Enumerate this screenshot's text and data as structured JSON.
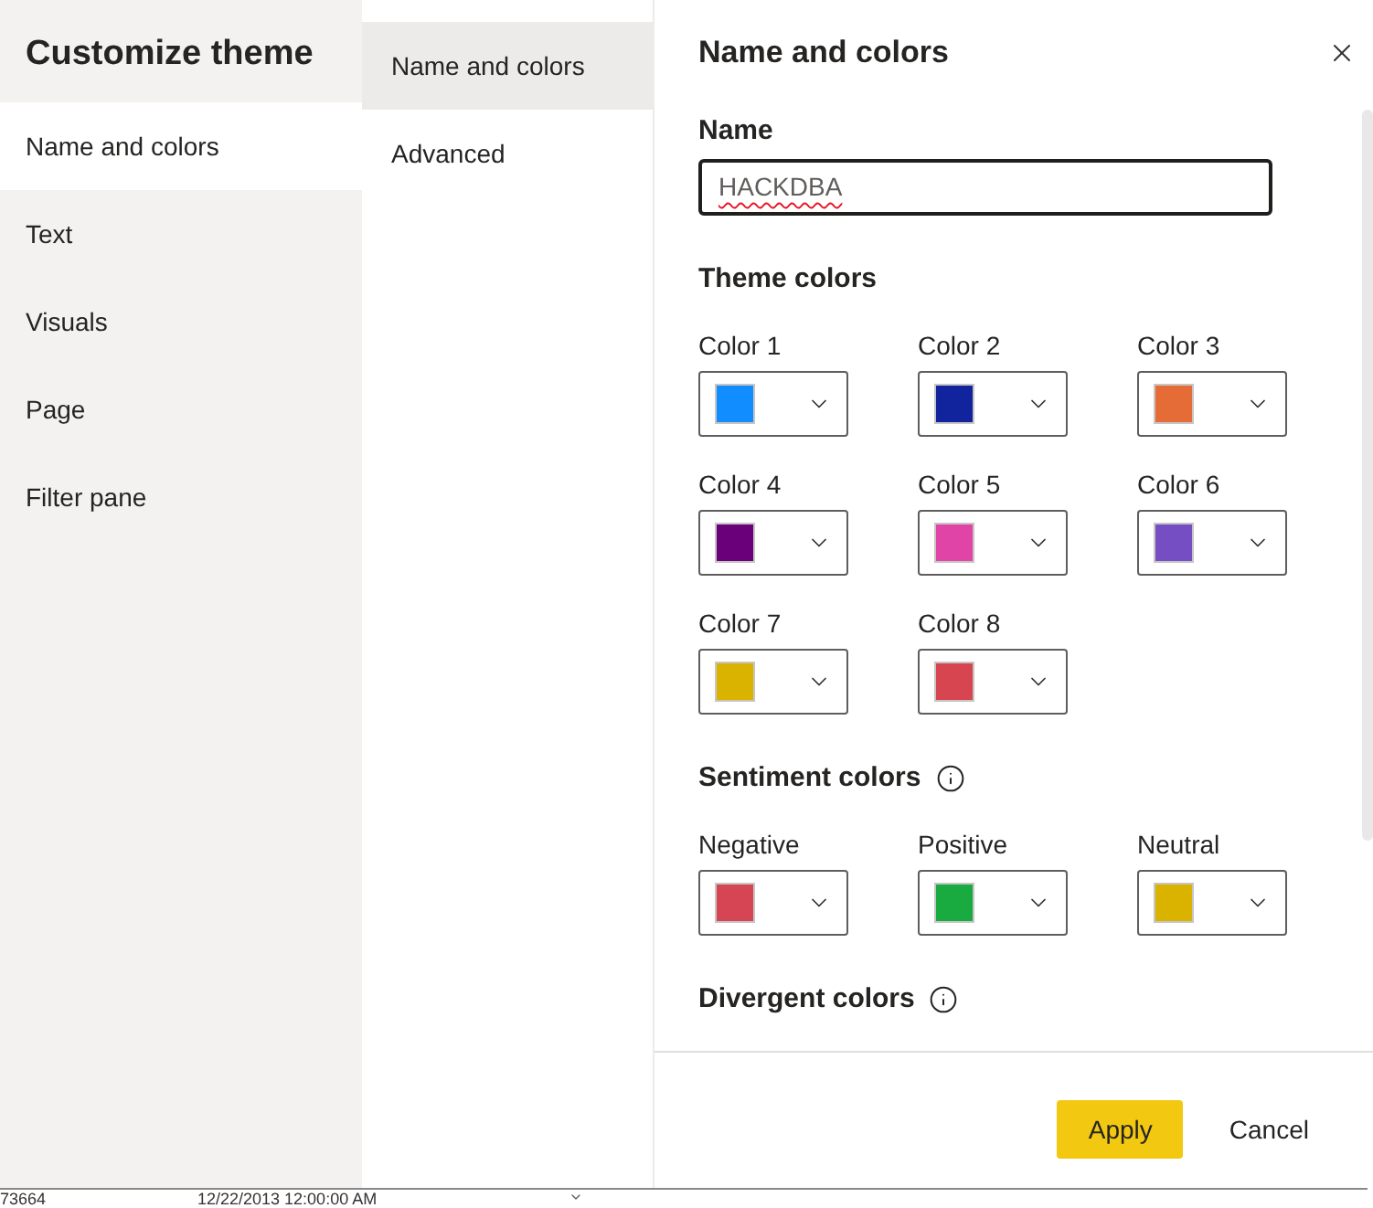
{
  "dialog": {
    "title": "Customize theme"
  },
  "nav": [
    {
      "label": "Name and colors",
      "selected": true
    },
    {
      "label": "Text",
      "selected": false
    },
    {
      "label": "Visuals",
      "selected": false
    },
    {
      "label": "Page",
      "selected": false
    },
    {
      "label": "Filter pane",
      "selected": false
    }
  ],
  "subnav": [
    {
      "label": "Name and colors",
      "selected": true
    },
    {
      "label": "Advanced",
      "selected": false
    }
  ],
  "panel": {
    "title": "Name and colors",
    "name_field": {
      "label": "Name",
      "value": "HACKDBA",
      "misspelled": true
    },
    "sections": [
      {
        "title": "Theme colors",
        "pickers": [
          {
            "label": "Color 1",
            "color": "#118dff"
          },
          {
            "label": "Color 2",
            "color": "#12239e"
          },
          {
            "label": "Color 3",
            "color": "#e66c37"
          },
          {
            "label": "Color 4",
            "color": "#6b007b"
          },
          {
            "label": "Color 5",
            "color": "#e044a7"
          },
          {
            "label": "Color 6",
            "color": "#744ec2"
          },
          {
            "label": "Color 7",
            "color": "#d9b300"
          },
          {
            "label": "Color 8",
            "color": "#d64550"
          }
        ]
      },
      {
        "title": "Sentiment colors",
        "info": true,
        "pickers": [
          {
            "label": "Negative",
            "color": "#d64554"
          },
          {
            "label": "Positive",
            "color": "#1aab40"
          },
          {
            "label": "Neutral",
            "color": "#d9b300"
          }
        ]
      },
      {
        "title": "Divergent colors",
        "info": true
      }
    ]
  },
  "buttons": [
    {
      "label": "Apply",
      "kind": "primary"
    },
    {
      "label": "Cancel",
      "kind": "secondary"
    }
  ],
  "background_row": {
    "cells": [
      "73664",
      "12/22/2013 12:00:00 AM"
    ]
  }
}
